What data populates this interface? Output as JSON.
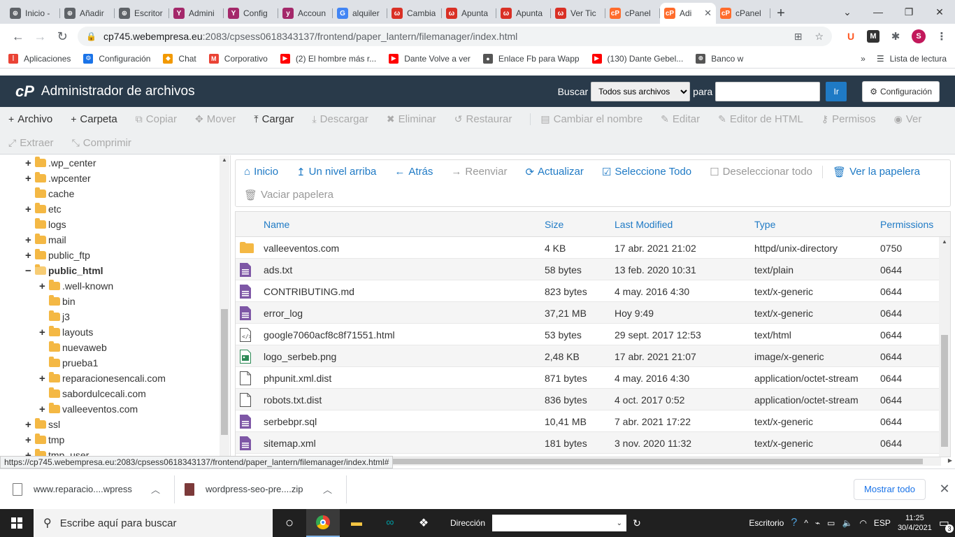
{
  "browser": {
    "tabs": [
      {
        "label": "Inicio -",
        "color": "#5f6368",
        "glyph": "⊕"
      },
      {
        "label": "Añadir",
        "color": "#5f6368",
        "glyph": "⊕"
      },
      {
        "label": "Escritor",
        "color": "#5f6368",
        "glyph": "⊕"
      },
      {
        "label": "Admini",
        "color": "#a4286a",
        "glyph": "Y"
      },
      {
        "label": "Config",
        "color": "#a4286a",
        "glyph": "Y"
      },
      {
        "label": "Accoun",
        "color": "#a4286a",
        "glyph": "y"
      },
      {
        "label": "alquiler",
        "color": "#4285f4",
        "glyph": "G"
      },
      {
        "label": "Cambia",
        "color": "#d93025",
        "glyph": "ω"
      },
      {
        "label": "Apunta",
        "color": "#d93025",
        "glyph": "ω"
      },
      {
        "label": "Apunta",
        "color": "#d93025",
        "glyph": "ω"
      },
      {
        "label": "Ver Tic",
        "color": "#d93025",
        "glyph": "ω"
      },
      {
        "label": "cPanel",
        "color": "#ff6c2c",
        "glyph": "cP"
      },
      {
        "label": "Adi",
        "color": "#ff6c2c",
        "glyph": "cP",
        "active": true
      },
      {
        "label": "cPanel",
        "color": "#ff6c2c",
        "glyph": "cP"
      }
    ],
    "url_host": "cp745.webempresa.eu",
    "url_path": ":2083/cpsess0618343137/frontend/paper_lantern/filemanager/index.html",
    "profile_initial": "S",
    "bookmarks": [
      {
        "label": "Aplicaciones",
        "color": "#ea4335",
        "glyph": "⋮"
      },
      {
        "label": "Configuración",
        "color": "#1a73e8",
        "glyph": "⚙"
      },
      {
        "label": "Chat",
        "color": "#f29900",
        "glyph": "◆"
      },
      {
        "label": "Corporativo",
        "color": "#ea4335",
        "glyph": "M"
      },
      {
        "label": "(2) El hombre más r...",
        "color": "#ff0000",
        "glyph": "▶"
      },
      {
        "label": "Dante Volve a ver",
        "color": "#ff0000",
        "glyph": "▶"
      },
      {
        "label": "Enlace Fb para Wapp",
        "color": "#555555",
        "glyph": "●"
      },
      {
        "label": "(130) Dante Gebel...",
        "color": "#ff0000",
        "glyph": "▶"
      },
      {
        "label": "Banco w",
        "color": "#555555",
        "glyph": "⊕"
      }
    ],
    "reading_list": "Lista de lectura",
    "status_url": "https://cp745.webempresa.eu:2083/cpsess0618343137/frontend/paper_lantern/filemanager/index.html#"
  },
  "cpanel": {
    "logo": "cP",
    "title": "Administrador de archivos",
    "search_label": "Buscar",
    "search_scope": "Todos sus archivos",
    "for_label": "para",
    "go_label": "Ir",
    "settings_label": "Configuración"
  },
  "toolbar": {
    "row1": [
      {
        "label": "Archivo",
        "icon": "+",
        "enabled": true,
        "name": "new-file-button"
      },
      {
        "label": "Carpeta",
        "icon": "+",
        "enabled": true,
        "name": "new-folder-button"
      },
      {
        "label": "Copiar",
        "icon": "⧉",
        "enabled": false,
        "name": "copy-button"
      },
      {
        "label": "Mover",
        "icon": "✥",
        "enabled": false,
        "name": "move-button"
      },
      {
        "label": "Cargar",
        "icon": "⤒",
        "enabled": true,
        "name": "upload-button"
      },
      {
        "label": "Descargar",
        "icon": "⤓",
        "enabled": false,
        "name": "download-button"
      },
      {
        "label": "Eliminar",
        "icon": "✖",
        "enabled": false,
        "name": "delete-button"
      },
      {
        "label": "Restaurar",
        "icon": "↺",
        "enabled": false,
        "name": "restore-button"
      },
      {
        "label": "Cambiar el nombre",
        "icon": "▤",
        "enabled": false,
        "name": "rename-button"
      },
      {
        "label": "Editar",
        "icon": "✎",
        "enabled": false,
        "name": "edit-button"
      },
      {
        "label": "Editor de HTML",
        "icon": "✎",
        "enabled": false,
        "name": "html-editor-button"
      },
      {
        "label": "Permisos",
        "icon": "⚷",
        "enabled": false,
        "name": "permissions-button"
      },
      {
        "label": "Ver",
        "icon": "◉",
        "enabled": false,
        "name": "view-button"
      }
    ],
    "row2": [
      {
        "label": "Extraer",
        "icon": "⤢",
        "enabled": false,
        "name": "extract-button"
      },
      {
        "label": "Comprimir",
        "icon": "⤡",
        "enabled": false,
        "name": "compress-button"
      }
    ]
  },
  "tree": [
    {
      "label": ".wp_center",
      "depth": 0,
      "toggle": "+"
    },
    {
      "label": ".wpcenter",
      "depth": 0,
      "toggle": "+"
    },
    {
      "label": "cache",
      "depth": 0,
      "toggle": ""
    },
    {
      "label": "etc",
      "depth": 0,
      "toggle": "+"
    },
    {
      "label": "logs",
      "depth": 0,
      "toggle": ""
    },
    {
      "label": "mail",
      "depth": 0,
      "toggle": "+"
    },
    {
      "label": "public_ftp",
      "depth": 0,
      "toggle": "+"
    },
    {
      "label": "public_html",
      "depth": 0,
      "toggle": "−",
      "selected": true
    },
    {
      "label": ".well-known",
      "depth": 1,
      "toggle": "+"
    },
    {
      "label": "bin",
      "depth": 1,
      "toggle": ""
    },
    {
      "label": "j3",
      "depth": 1,
      "toggle": ""
    },
    {
      "label": "layouts",
      "depth": 1,
      "toggle": "+"
    },
    {
      "label": "nuevaweb",
      "depth": 1,
      "toggle": ""
    },
    {
      "label": "prueba1",
      "depth": 1,
      "toggle": ""
    },
    {
      "label": "reparacionesencali.com",
      "depth": 1,
      "toggle": "+"
    },
    {
      "label": "sabordulcecali.com",
      "depth": 1,
      "toggle": ""
    },
    {
      "label": "valleeventos.com",
      "depth": 1,
      "toggle": "+"
    },
    {
      "label": "ssl",
      "depth": 0,
      "toggle": "+"
    },
    {
      "label": "tmp",
      "depth": 0,
      "toggle": "+"
    },
    {
      "label": "tmp_user",
      "depth": 0,
      "toggle": "+"
    }
  ],
  "nav": {
    "row1": [
      {
        "label": "Inicio",
        "icon": "⌂",
        "enabled": true,
        "name": "home-button"
      },
      {
        "label": "Un nivel arriba",
        "icon": "↥",
        "enabled": true,
        "name": "up-one-level-button"
      },
      {
        "label": "Atrás",
        "icon": "←",
        "enabled": true,
        "name": "back-button"
      },
      {
        "label": "Reenviar",
        "icon": "→",
        "enabled": false,
        "name": "forward-button"
      },
      {
        "label": "Actualizar",
        "icon": "⟳",
        "enabled": true,
        "name": "reload-button"
      },
      {
        "label": "Seleccione Todo",
        "icon": "☑",
        "enabled": true,
        "name": "select-all-button"
      },
      {
        "label": "Deseleccionar todo",
        "icon": "☐",
        "enabled": false,
        "name": "unselect-all-button"
      },
      {
        "label": "Ver la papelera",
        "icon": "🗑",
        "enabled": true,
        "name": "view-trash-button"
      }
    ],
    "row2": [
      {
        "label": "Vaciar papelera",
        "icon": "🗑",
        "enabled": false,
        "name": "empty-trash-button"
      }
    ]
  },
  "files": {
    "headers": [
      "Name",
      "Size",
      "Last Modified",
      "Type",
      "Permissions"
    ],
    "rows": [
      {
        "name": "valleeventos.com",
        "size": "4 KB",
        "modified": "17 abr. 2021 21:02",
        "type": "httpd/unix-directory",
        "perms": "0750",
        "icon": "folder"
      },
      {
        "name": "ads.txt",
        "size": "58 bytes",
        "modified": "13 feb. 2020 10:31",
        "type": "text/plain",
        "perms": "0644",
        "icon": "text"
      },
      {
        "name": "CONTRIBUTING.md",
        "size": "823 bytes",
        "modified": "4 may. 2016 4:30",
        "type": "text/x-generic",
        "perms": "0644",
        "icon": "text"
      },
      {
        "name": "error_log",
        "size": "37,21 MB",
        "modified": "Hoy 9:49",
        "type": "text/x-generic",
        "perms": "0644",
        "icon": "text"
      },
      {
        "name": "google7060acf8c8f71551.html",
        "size": "53 bytes",
        "modified": "29 sept. 2017 12:53",
        "type": "text/html",
        "perms": "0644",
        "icon": "html"
      },
      {
        "name": "logo_serbeb.png",
        "size": "2,48 KB",
        "modified": "17 abr. 2021 21:07",
        "type": "image/x-generic",
        "perms": "0644",
        "icon": "image"
      },
      {
        "name": "phpunit.xml.dist",
        "size": "871 bytes",
        "modified": "4 may. 2016 4:30",
        "type": "application/octet-stream",
        "perms": "0644",
        "icon": "blank"
      },
      {
        "name": "robots.txt.dist",
        "size": "836 bytes",
        "modified": "4 oct. 2017 0:52",
        "type": "application/octet-stream",
        "perms": "0644",
        "icon": "blank"
      },
      {
        "name": "serbebpr.sql",
        "size": "10,41 MB",
        "modified": "7 abr. 2021 17:22",
        "type": "text/x-generic",
        "perms": "0644",
        "icon": "text"
      },
      {
        "name": "sitemap.xml",
        "size": "181 bytes",
        "modified": "3 nov. 2020 11:32",
        "type": "text/x-generic",
        "perms": "0644",
        "icon": "text"
      }
    ]
  },
  "downloads": {
    "items": [
      {
        "label": "www.reparacio....wpress",
        "kind": "file"
      },
      {
        "label": "wordpress-seo-pre....zip",
        "kind": "zip"
      }
    ],
    "show_all": "Mostrar todo"
  },
  "taskbar": {
    "search_placeholder": "Escribe aquí para buscar",
    "address_label": "Dirección",
    "desktop_label": "Escritorio",
    "lang": "ESP",
    "time": "11:25",
    "date": "30/4/2021",
    "notif_count": "3"
  }
}
